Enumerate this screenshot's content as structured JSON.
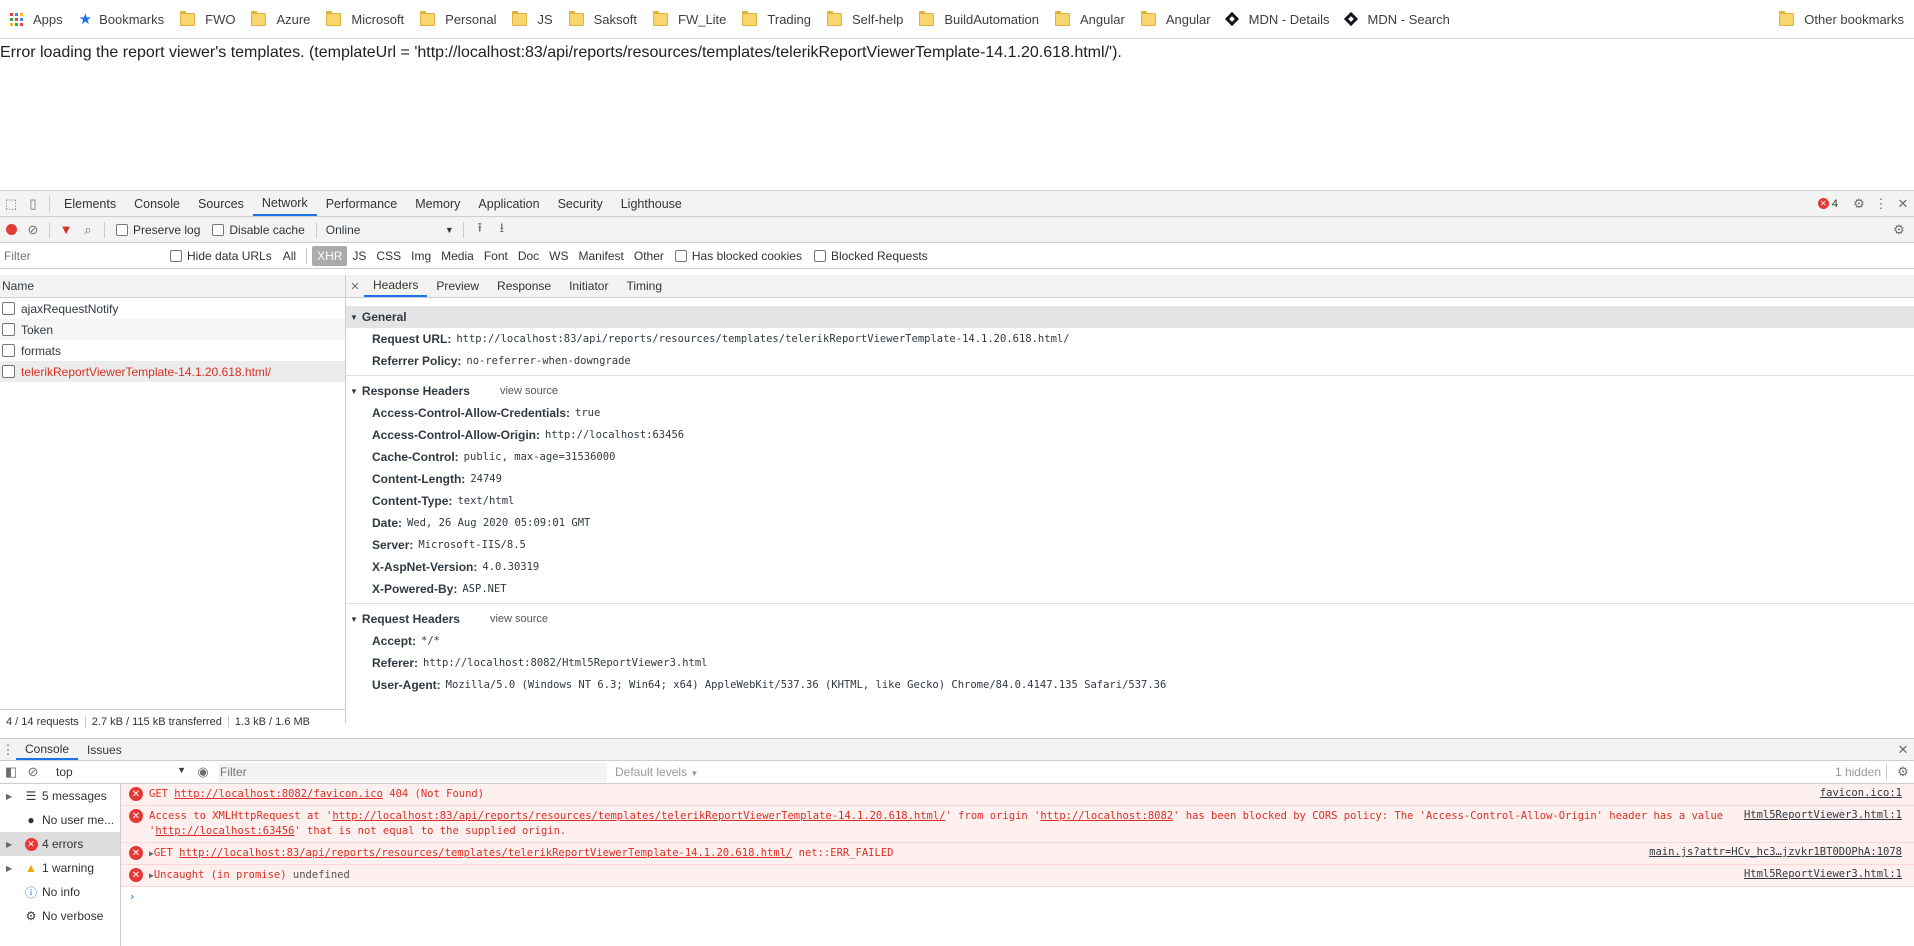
{
  "bookmarks": {
    "apps": "Apps",
    "bookmarks": "Bookmarks",
    "items": [
      "FWO",
      "Azure",
      "Microsoft",
      "Personal",
      "JS",
      "Saksoft",
      "FW_Lite",
      "Trading",
      "Self-help",
      "BuildAutomation",
      "Angular",
      "Angular"
    ],
    "mdn1": "MDN - Details",
    "mdn2": "MDN - Search",
    "other": "Other bookmarks"
  },
  "page": {
    "error_text": "Error loading the report viewer's templates. (templateUrl = 'http://localhost:83/api/reports/resources/templates/telerikReportViewerTemplate-14.1.20.618.html/')."
  },
  "devtools": {
    "tabs": [
      "Elements",
      "Console",
      "Sources",
      "Network",
      "Performance",
      "Memory",
      "Application",
      "Security",
      "Lighthouse"
    ],
    "active_tab": "Network",
    "error_count": "4",
    "toolbar": {
      "preserve_log": "Preserve log",
      "disable_cache": "Disable cache",
      "throttle": "Online"
    },
    "filter": {
      "placeholder": "Filter",
      "hide_data_urls": "Hide data URLs",
      "types": [
        "All",
        "XHR",
        "JS",
        "CSS",
        "Img",
        "Media",
        "Font",
        "Doc",
        "WS",
        "Manifest",
        "Other"
      ],
      "selected": "XHR",
      "blocked_cookies": "Has blocked cookies",
      "blocked_requests": "Blocked Requests"
    },
    "list": {
      "header": "Name",
      "rows": [
        "ajaxRequestNotify",
        "Token",
        "formats",
        "telerikReportViewerTemplate-14.1.20.618.html/"
      ]
    },
    "status": [
      "4 / 14 requests",
      "2.7 kB / 115 kB transferred",
      "1.3 kB / 1.6 MB"
    ],
    "detail_tabs": [
      "Headers",
      "Preview",
      "Response",
      "Initiator",
      "Timing"
    ],
    "general": {
      "title": "General",
      "request_url_k": "Request URL:",
      "request_url_v": "http://localhost:83/api/reports/resources/templates/telerikReportViewerTemplate-14.1.20.618.html/",
      "referrer_k": "Referrer Policy:",
      "referrer_v": "no-referrer-when-downgrade"
    },
    "response_headers": {
      "title": "Response Headers",
      "view_source": "view source",
      "rows": [
        {
          "k": "Access-Control-Allow-Credentials:",
          "v": "true"
        },
        {
          "k": "Access-Control-Allow-Origin:",
          "v": "http://localhost:63456"
        },
        {
          "k": "Cache-Control:",
          "v": "public, max-age=31536000"
        },
        {
          "k": "Content-Length:",
          "v": "24749"
        },
        {
          "k": "Content-Type:",
          "v": "text/html"
        },
        {
          "k": "Date:",
          "v": "Wed, 26 Aug 2020 05:09:01 GMT"
        },
        {
          "k": "Server:",
          "v": "Microsoft-IIS/8.5"
        },
        {
          "k": "X-AspNet-Version:",
          "v": "4.0.30319"
        },
        {
          "k": "X-Powered-By:",
          "v": "ASP.NET"
        }
      ]
    },
    "request_headers": {
      "title": "Request Headers",
      "view_source": "view source",
      "rows": [
        {
          "k": "Accept:",
          "v": "*/*"
        },
        {
          "k": "Referer:",
          "v": "http://localhost:8082/Html5ReportViewer3.html"
        },
        {
          "k": "User-Agent:",
          "v": "Mozilla/5.0 (Windows NT 6.3; Win64; x64) AppleWebKit/537.36 (KHTML, like Gecko) Chrome/84.0.4147.135 Safari/537.36"
        }
      ]
    }
  },
  "console": {
    "tabs": [
      "Console",
      "Issues"
    ],
    "context": "top",
    "filter_placeholder": "Filter",
    "levels": "Default levels",
    "hidden": "1 hidden",
    "sidebar": [
      "5 messages",
      "No user me...",
      "4 errors",
      "1 warning",
      "No info",
      "No verbose"
    ],
    "m1": {
      "a": "GET ",
      "b": "http://localhost:8082/favicon.ico",
      "c": " 404 (Not Found)",
      "src": "favicon.ico:1"
    },
    "m2": {
      "a": "Access to XMLHttpRequest at '",
      "b": "http://localhost:83/api/reports/resources/templates/telerikReportViewerTemplate-14.1.20.618.html/",
      "c": "' from origin '",
      "d": "http://localhost:8082",
      "e": "' has been blocked by CORS policy: The 'Access-Control-Allow-Origin' header has a value '",
      "f": "http://localhost:63456",
      "g": "' that is not equal to the supplied origin.",
      "src": "Html5ReportViewer3.html:1"
    },
    "m3": {
      "a": "GET ",
      "b": "http://localhost:83/api/reports/resources/templates/telerikReportViewerTemplate-14.1.20.618.html/",
      "c": " net::ERR_FAILED",
      "src": "main.js?attr=HCv_hc3…jzvkr1BT0DOPhA:1078"
    },
    "m4": {
      "a": "Uncaught (in promise)",
      "b": " undefined",
      "src": "Html5ReportViewer3.html:1"
    }
  },
  "colors": {
    "accent": "#1a73e8",
    "error": "#d93025",
    "error_bg": "#fff0f0"
  }
}
